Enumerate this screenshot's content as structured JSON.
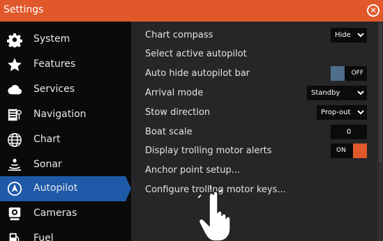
{
  "window": {
    "title": "Settings",
    "close_icon": "close-icon"
  },
  "colors": {
    "titlebar": "#e1582a",
    "active_item": "#1e5aa8",
    "toggle_on": "#e1582a",
    "toggle_off": "#4f6e8a"
  },
  "sidebar": {
    "items": [
      {
        "label": "System",
        "icon": "gear-icon"
      },
      {
        "label": "Features",
        "icon": "star-icon"
      },
      {
        "label": "Services",
        "icon": "cloud-icon"
      },
      {
        "label": "Navigation",
        "icon": "navigation-icon"
      },
      {
        "label": "Chart",
        "icon": "globe-icon"
      },
      {
        "label": "Sonar",
        "icon": "sonar-icon"
      },
      {
        "label": "Autopilot",
        "icon": "autopilot-icon",
        "active": true
      },
      {
        "label": "Cameras",
        "icon": "camera-icon"
      },
      {
        "label": "Fuel",
        "icon": "fuel-icon"
      }
    ]
  },
  "settings": [
    {
      "label": "Chart compass",
      "control": "dropdown",
      "value": "Hide"
    },
    {
      "label": "Select active autopilot",
      "control": "none"
    },
    {
      "label": "Auto hide autopilot bar",
      "control": "toggle",
      "value": "OFF"
    },
    {
      "label": "Arrival mode",
      "control": "dropdown",
      "value": "Standby"
    },
    {
      "label": "Stow direction",
      "control": "dropdown",
      "value": "Prop-out"
    },
    {
      "label": "Boat scale",
      "control": "number",
      "value": "0"
    },
    {
      "label": "Display trolling motor alerts",
      "control": "toggle",
      "value": "ON"
    },
    {
      "label": "Anchor point setup...",
      "control": "none"
    },
    {
      "label": "Configure trolling motor keys...",
      "control": "none"
    }
  ],
  "pointer": {
    "icon": "hand-pointer-icon"
  }
}
